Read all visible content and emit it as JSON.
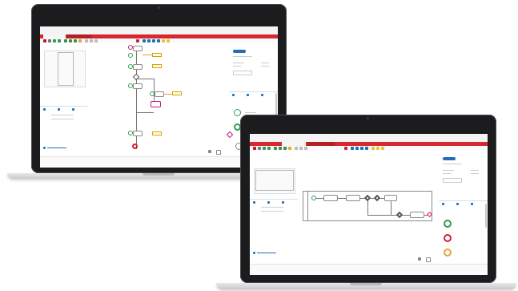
{
  "left_laptop": {
    "brand": "",
    "brand_suffix": "",
    "user": "",
    "tabs": [
      "",
      ""
    ],
    "panel_title": "",
    "props_title": "",
    "status": ""
  },
  "right_laptop": {
    "brand": "",
    "brand_suffix": "",
    "user": "",
    "tabs": [
      "",
      ""
    ],
    "panel_title": "",
    "props_title": "",
    "legend_items": [
      "",
      "",
      ""
    ],
    "status": ""
  },
  "colors": {
    "brand_red": "#c8102e",
    "tab_red": "#d7282f",
    "start_green": "#2e9e4f",
    "end_red": "#d21f3c",
    "intermediate_orange": "#e8a33b",
    "gateway_magenta": "#c2187f",
    "toolbar_blue": "#1e6fb8"
  }
}
